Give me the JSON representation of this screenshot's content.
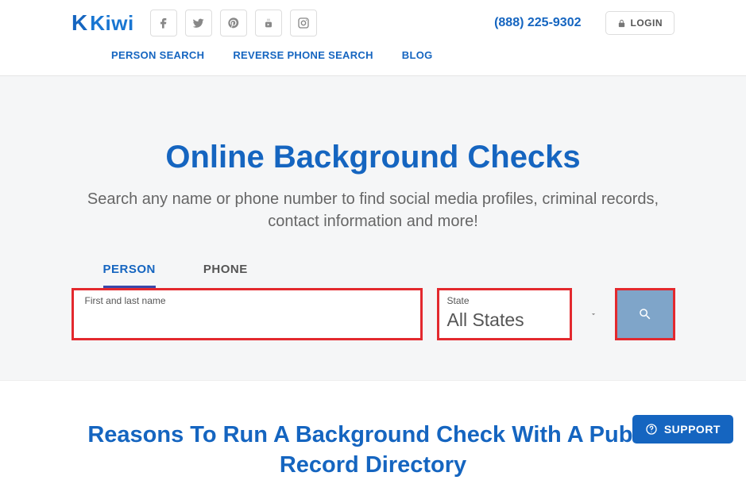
{
  "header": {
    "logo_text": "Kiwi",
    "phone": "(888) 225-9302",
    "login": "LOGIN"
  },
  "nav": {
    "items": [
      "PERSON SEARCH",
      "REVERSE PHONE SEARCH",
      "BLOG"
    ]
  },
  "hero": {
    "title": "Online Background Checks",
    "subtitle": "Search any name or phone number to find social media profiles, criminal records, contact information and more!"
  },
  "search": {
    "tabs": {
      "person": "PERSON",
      "phone": "PHONE"
    },
    "name_label": "First and last name",
    "name_value": "",
    "state_label": "State",
    "state_value": "All States"
  },
  "section2": {
    "title": "Reasons To Run A Background Check With A Public Record Directory"
  },
  "support": {
    "label": "SUPPORT"
  }
}
